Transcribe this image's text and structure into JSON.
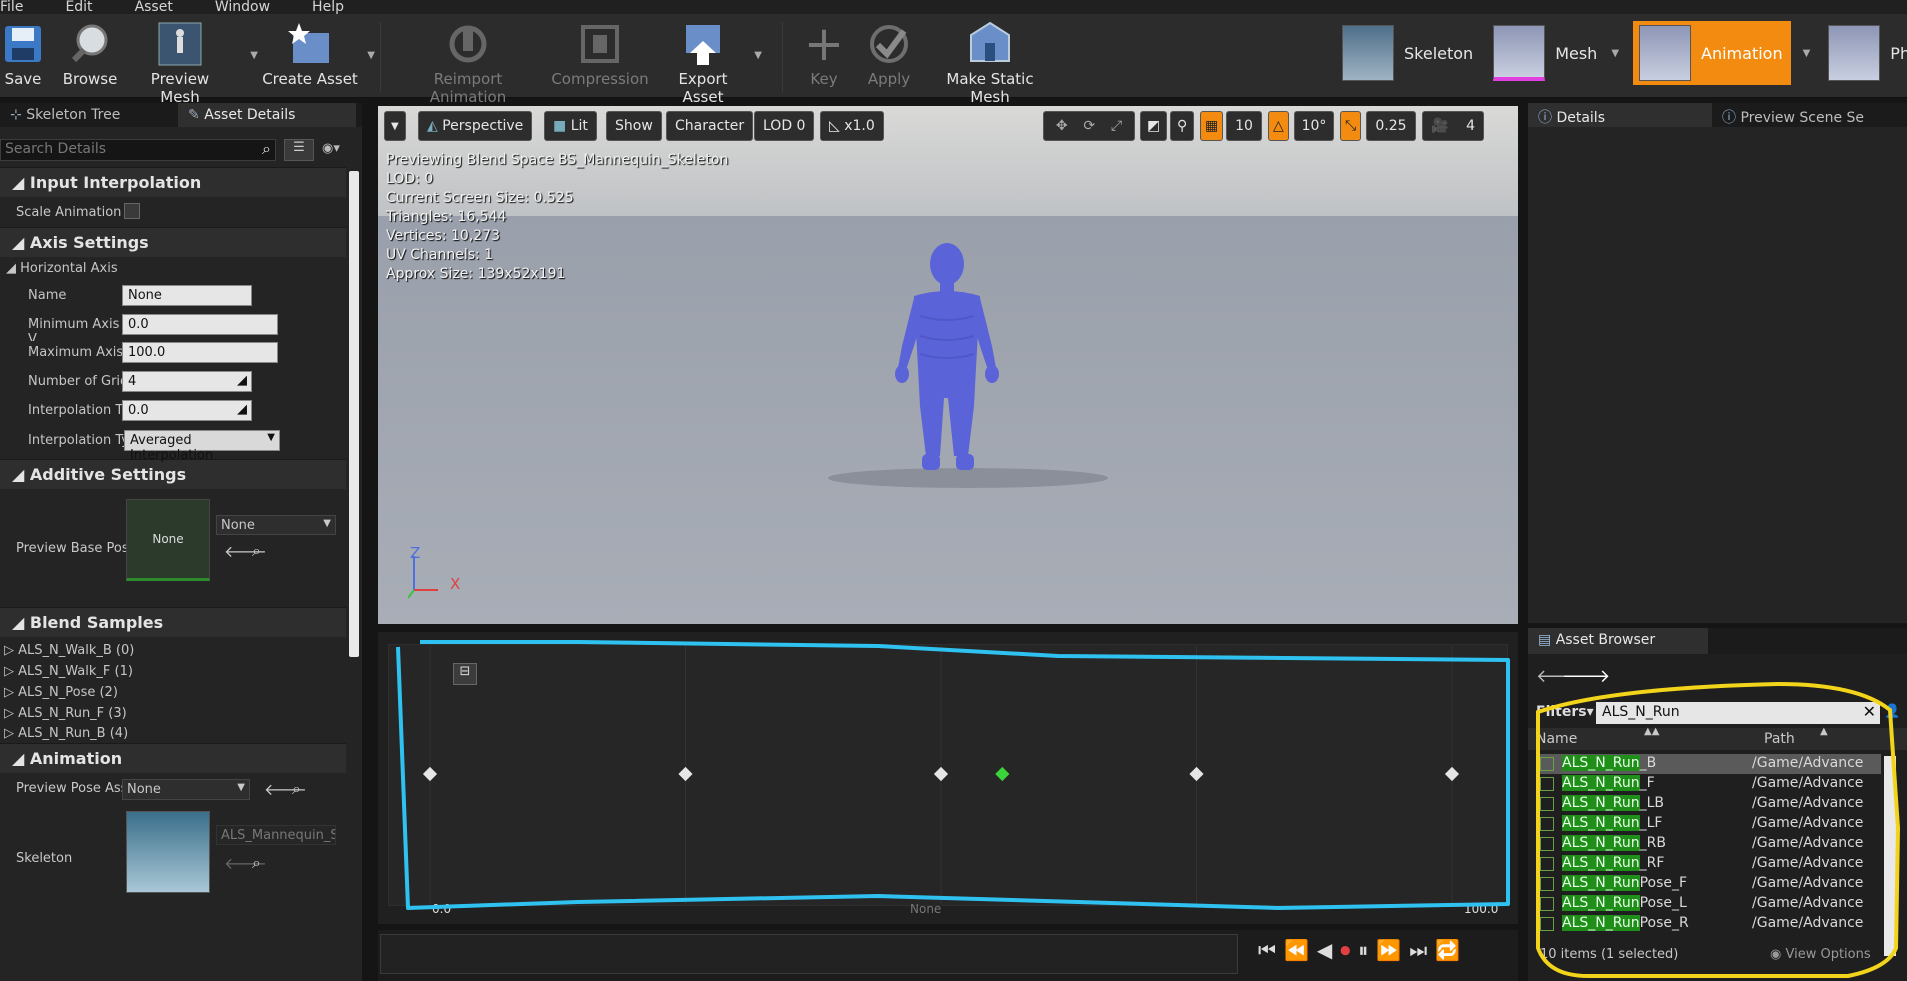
{
  "menu": [
    "File",
    "Edit",
    "Asset",
    "Window",
    "Help"
  ],
  "toolbar": {
    "save": "Save",
    "browse": "Browse",
    "preview_mesh": "Preview Mesh",
    "create_asset": "Create Asset",
    "reimport": "Reimport Animation",
    "compression": "Compression",
    "export_asset": "Export Asset",
    "key": "Key",
    "apply": "Apply",
    "make_static_mesh": "Make Static Mesh"
  },
  "modes": {
    "skeleton": "Skeleton",
    "mesh": "Mesh",
    "animation": "Animation",
    "physics": "Physics"
  },
  "left_tabs": {
    "skeleton_tree": "Skeleton Tree",
    "asset_details": "Asset Details"
  },
  "left": {
    "search_placeholder": "Search Details",
    "input_interpolation": "Input Interpolation",
    "scale_animation": "Scale Animation",
    "axis_settings": "Axis Settings",
    "horizontal_axis": "Horizontal Axis",
    "name_label": "Name",
    "name_value": "None",
    "min_label": "Minimum Axis V",
    "min_value": "0.0",
    "max_label": "Maximum Axis",
    "max_value": "100.0",
    "grid_label": "Number of Grid",
    "grid_value": "4",
    "interp_time_label": "Interpolation Tir",
    "interp_time_value": "0.0",
    "interp_type_label": "Interpolation Ty",
    "interp_type_value": "Averaged Interpolation",
    "additive_settings": "Additive Settings",
    "preview_base_label": "Preview Base Pos",
    "preview_base_thumb": "None",
    "preview_base_combo": "None",
    "blend_samples": "Blend Samples",
    "samples": [
      "ALS_N_Walk_B (0)",
      "ALS_N_Walk_F (1)",
      "ALS_N_Pose (2)",
      "ALS_N_Run_F (3)",
      "ALS_N_Run_B (4)"
    ],
    "animation": "Animation",
    "preview_pose_label": "Preview Pose Ass",
    "preview_pose_value": "None",
    "skeleton_label": "Skeleton",
    "skeleton_value": "ALS_Mannequin_S"
  },
  "viewport": {
    "perspective": "Perspective",
    "lit": "Lit",
    "show": "Show",
    "character": "Character",
    "lod": "LOD 0",
    "speed": "x1.0",
    "grid_snap": "10",
    "rot_snap": "10°",
    "scale_snap": "0.25",
    "cam_speed": "4",
    "info": [
      "Previewing Blend Space BS_Mannequin_Skeleton",
      "LOD: 0",
      "Current Screen Size: 0.525",
      "Triangles: 16,544",
      "Vertices: 10,273",
      "UV Channels: 1",
      "Approx Size: 139x52x191"
    ],
    "axis_z": "Z",
    "axis_x": "X"
  },
  "graph": {
    "min_label": "0.0",
    "axis_name": "None",
    "max_label": "100.0",
    "samples_value": [
      0,
      25,
      50,
      75,
      100
    ],
    "preview_point": 56
  },
  "right_tabs": {
    "details": "Details",
    "preview_scene": "Preview Scene Se"
  },
  "asset_browser": {
    "title": "Asset Browser",
    "filters": "Filters",
    "search": "ALS_N_Run",
    "col_name": "Name",
    "col_path": "Path",
    "items": [
      {
        "match": "ALS_N_Run",
        "rest": "_B",
        "path": "/Game/Advance"
      },
      {
        "match": "ALS_N_Run",
        "rest": "_F",
        "path": "/Game/Advance"
      },
      {
        "match": "ALS_N_Run",
        "rest": "_LB",
        "path": "/Game/Advance"
      },
      {
        "match": "ALS_N_Run",
        "rest": "_LF",
        "path": "/Game/Advance"
      },
      {
        "match": "ALS_N_Run",
        "rest": "_RB",
        "path": "/Game/Advance"
      },
      {
        "match": "ALS_N_Run",
        "rest": "_RF",
        "path": "/Game/Advance"
      },
      {
        "match": "ALS_N_Run",
        "rest": "Pose_F",
        "path": "/Game/Advance"
      },
      {
        "match": "ALS_N_Run",
        "rest": "Pose_L",
        "path": "/Game/Advance"
      },
      {
        "match": "ALS_N_Run",
        "rest": "Pose_R",
        "path": "/Game/Advance"
      }
    ],
    "status": "10 items (1 selected)",
    "view_options": "View Options"
  },
  "colors": {
    "accent": "#f28b10",
    "highlight_blue": "#2fc2f0",
    "highlight_yellow": "#f2d41a",
    "match_green": "#1f8f1a"
  }
}
